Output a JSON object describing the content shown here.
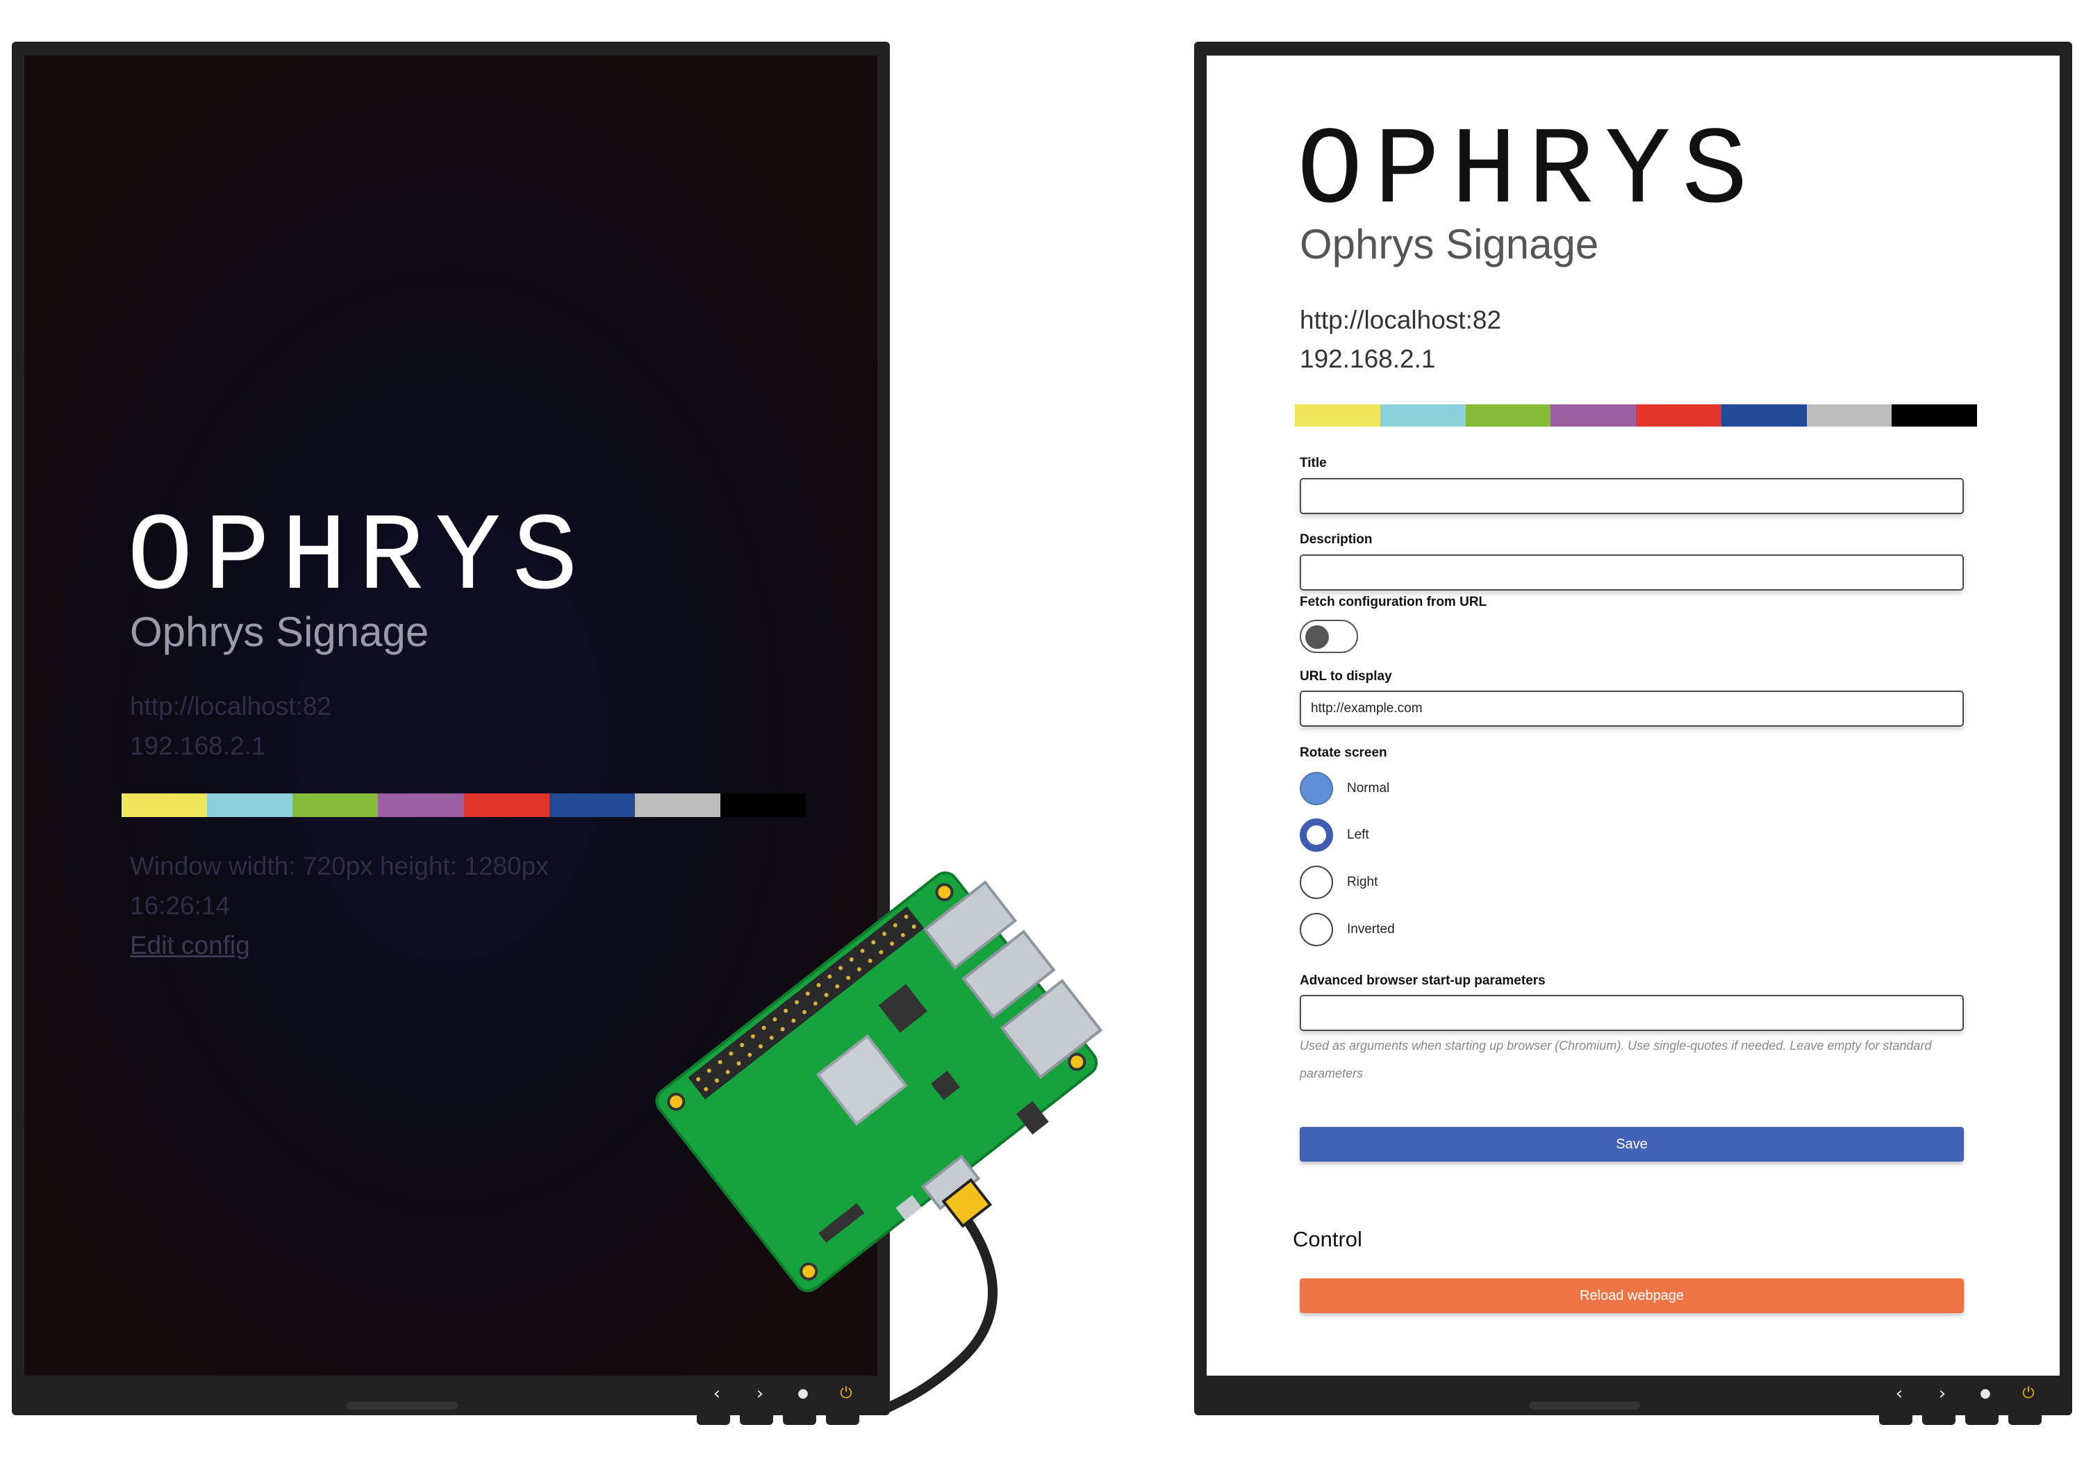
{
  "signage": {
    "logo": "OPHRYS",
    "subtitle": "Ophrys Signage",
    "url": "http://localhost:82",
    "ip": "192.168.2.1",
    "color_bars": [
      "#f0e65c",
      "#8cd0dc",
      "#86bb3a",
      "#9b5ea3",
      "#e2352b",
      "#224a96",
      "#bdbdbd",
      "#000000"
    ]
  },
  "left_screen": {
    "window_info": "Window width: 720px height: 1280px",
    "time": "16:26:14",
    "edit_link": "Edit config"
  },
  "form": {
    "title_label": "Title",
    "title_value": "",
    "description_label": "Description",
    "description_value": "",
    "fetch_label": "Fetch configuration from URL",
    "fetch_enabled": false,
    "url_label": "URL to display",
    "url_value": "http://example.com",
    "rotate_label": "Rotate screen",
    "rotate_options": [
      "Normal",
      "Left",
      "Right",
      "Inverted"
    ],
    "rotate_selected": "Left",
    "advanced_label": "Advanced browser start-up parameters",
    "advanced_value": "",
    "advanced_help": "Used as arguments when starting up browser (Chromium). Use single-quotes if needed. Leave empty for standard parameters",
    "save_label": "Save"
  },
  "control": {
    "heading": "Control",
    "reload_label": "Reload webpage"
  },
  "monitor_controls": {
    "icons": [
      "chevron-left-icon",
      "chevron-right-icon",
      "dot-icon",
      "power-icon"
    ],
    "glyphs": [
      "‹",
      "›",
      "●",
      "⏻"
    ],
    "power_color": "#f0b400"
  }
}
